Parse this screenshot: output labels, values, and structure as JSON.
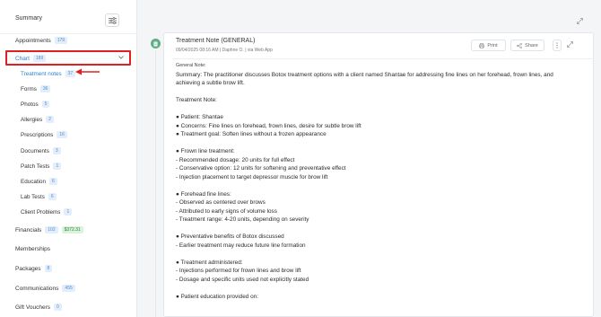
{
  "sidebar": {
    "title": "Summary",
    "items_top": [
      {
        "label": "Appointments",
        "badge": "179"
      }
    ],
    "chart": {
      "label": "Chart",
      "badge": "189"
    },
    "sub_items": [
      {
        "label": "Treatment notes",
        "badge": "37"
      },
      {
        "label": "Forms",
        "badge": "36"
      },
      {
        "label": "Photos",
        "badge": "5"
      },
      {
        "label": "Allergies",
        "badge": "2"
      },
      {
        "label": "Prescriptions",
        "badge": "16"
      },
      {
        "label": "Documents",
        "badge": "3"
      },
      {
        "label": "Patch Tests",
        "badge": "1"
      },
      {
        "label": "Education",
        "badge": "6"
      },
      {
        "label": "Lab Tests",
        "badge": "6"
      },
      {
        "label": "Client Problems",
        "badge": "1"
      }
    ],
    "financials": {
      "label": "Financials",
      "badge": "102",
      "amount": "$372.31"
    },
    "memberships": {
      "label": "Memberships"
    },
    "packages": {
      "label": "Packages",
      "badge": "8"
    },
    "communications": {
      "label": "Communications",
      "badge": "455"
    },
    "gift_vouchers": {
      "label": "Gift Vouchers",
      "badge": "0"
    }
  },
  "note": {
    "title": "Treatment Note (GENERAL)",
    "meta": "09/04/2025 08:16 AM | Daphne O. | via Web App",
    "print_label": "Print",
    "share_label": "Share",
    "general_label": "General Note:",
    "summary": "Summary: The practitioner discusses Botox treatment options with a client named Shantae for addressing fine lines on her forehead, frown lines, and achieving a subtle brow lift.",
    "heading": "Treatment Note:",
    "block1": "● Patient: Shantae\n● Concerns: Fine lines on forehead, frown lines, desire for subtle brow lift\n● Treatment goal: Soften lines without a frozen appearance",
    "block2": "● Frown line treatment:\n- Recommended dosage: 20 units for full effect\n- Conservative option: 12 units for softening and preventative effect\n- Injection placement to target depressor muscle for brow lift",
    "block3": "● Forehead fine lines:\n- Observed as centered over brows\n- Attributed to early signs of volume loss\n- Treatment range: 4-20 units, depending on severity",
    "block4": "● Preventative benefits of Botox discussed\n- Earlier treatment may reduce future line formation",
    "block5": "● Treatment administered:\n- Injections performed for frown lines and brow lift\n- Dosage and specific units used not explicitly stated",
    "block6": "● Patient education provided on:"
  }
}
